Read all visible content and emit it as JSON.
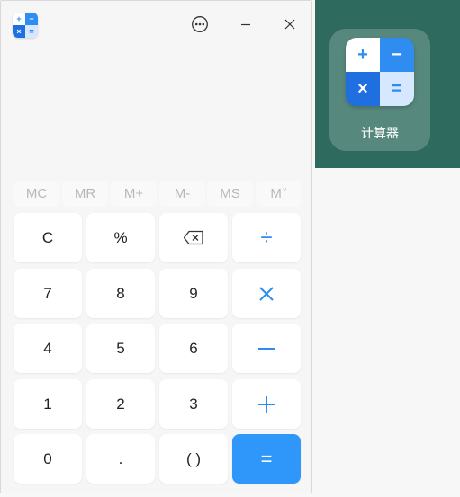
{
  "app": {
    "name": "计算器",
    "icon_glyphs": {
      "top_left": "+",
      "top_right": "−",
      "bottom_left": "×",
      "bottom_right": "="
    }
  },
  "titlebar": {
    "menu_icon": "more-horizontal-icon",
    "minimize_icon": "minimize-icon",
    "close_icon": "close-icon"
  },
  "display": {
    "expression": "",
    "result": ""
  },
  "memory": {
    "mc": "MC",
    "mr": "MR",
    "mplus": "M+",
    "mminus": "M-",
    "ms": "MS",
    "mlist": "M",
    "mlist_sup": "˅"
  },
  "keypad": {
    "clear": "C",
    "percent": "%",
    "divide": "÷",
    "seven": "7",
    "eight": "8",
    "nine": "9",
    "four": "4",
    "five": "5",
    "six": "6",
    "one": "1",
    "two": "2",
    "three": "3",
    "zero": "0",
    "decimal": ".",
    "parentheses": "( )",
    "equals": "="
  },
  "desktop": {
    "label": "计算器",
    "background": "#2e6b5e"
  },
  "colors": {
    "accent": "#2f96fa",
    "operator": "#2f8cf0",
    "memory_disabled": "#b8b8b8"
  }
}
